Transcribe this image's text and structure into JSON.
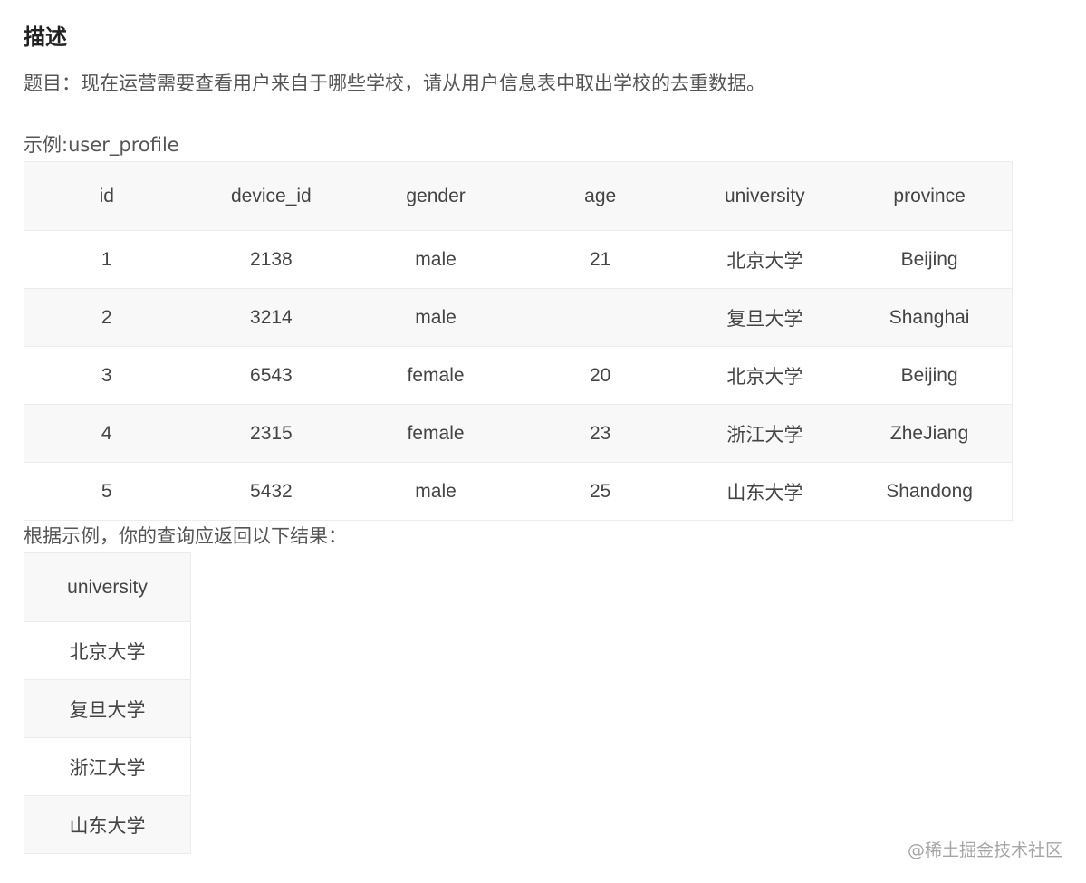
{
  "heading": "描述",
  "question": "题目：现在运营需要查看用户来自于哪些学校，请从用户信息表中取出学校的去重数据。",
  "example_label": "示例:user_profile",
  "example_table": {
    "headers": [
      "id",
      "device_id",
      "gender",
      "age",
      "university",
      "province"
    ],
    "rows": [
      [
        "1",
        "2138",
        "male",
        "21",
        "北京大学",
        "Beijing"
      ],
      [
        "2",
        "3214",
        "male",
        "",
        "复旦大学",
        "Shanghai"
      ],
      [
        "3",
        "6543",
        "female",
        "20",
        "北京大学",
        "Beijing"
      ],
      [
        "4",
        "2315",
        "female",
        "23",
        "浙江大学",
        "ZheJiang"
      ],
      [
        "5",
        "5432",
        "male",
        "25",
        "山东大学",
        "Shandong"
      ]
    ]
  },
  "result_label": "根据示例，你的查询应返回以下结果：",
  "result_table": {
    "headers": [
      "university"
    ],
    "rows": [
      [
        "北京大学"
      ],
      [
        "复旦大学"
      ],
      [
        "浙江大学"
      ],
      [
        "山东大学"
      ]
    ]
  },
  "watermark": "@稀土掘金技术社区"
}
